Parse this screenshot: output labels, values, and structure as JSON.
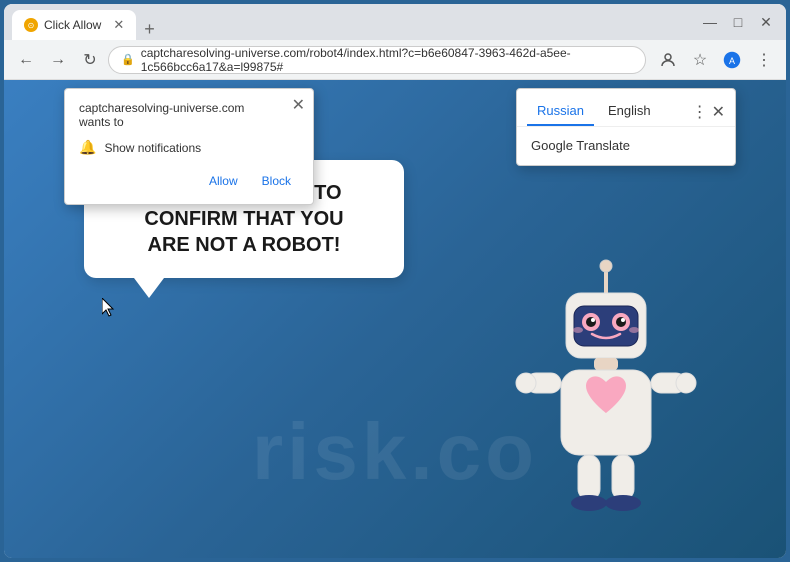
{
  "title_bar": {
    "tab_title": "Click Allow",
    "new_tab_label": "+",
    "minimize": "—",
    "maximize": "□",
    "close": "✕"
  },
  "address_bar": {
    "url": "captcharesolving-universe.com/robot4/index.html?c=b6e60847-3963-462d-a5ee-1c566bcc6a17&a=l99875#",
    "back_icon": "←",
    "forward_icon": "→",
    "refresh_icon": "↻",
    "lock_icon": "🔒",
    "star_icon": "☆",
    "profile_icon": "👤",
    "menu_icon": "⋮"
  },
  "notification_popup": {
    "site_text": "captcharesolving-universe.com wants to",
    "notification_label": "Show notifications",
    "allow_btn": "Allow",
    "block_btn": "Block",
    "close_icon": "✕"
  },
  "translate_popup": {
    "tab_russian": "Russian",
    "tab_english": "English",
    "service": "Google Translate",
    "more_icon": "⋮",
    "close_icon": "✕"
  },
  "speech_bubble": {
    "text_line1": "CLICK «ALLOW» TO CONFIRM THAT YOU",
    "text_line2": "ARE NOT A ROBOT!"
  },
  "watermark": {
    "text": "risk.co"
  },
  "colors": {
    "accent_blue": "#1a73e8",
    "tab_active_underline": "#1a73e8",
    "background_gradient_start": "#3a7fc1",
    "background_gradient_end": "#1a5276"
  }
}
